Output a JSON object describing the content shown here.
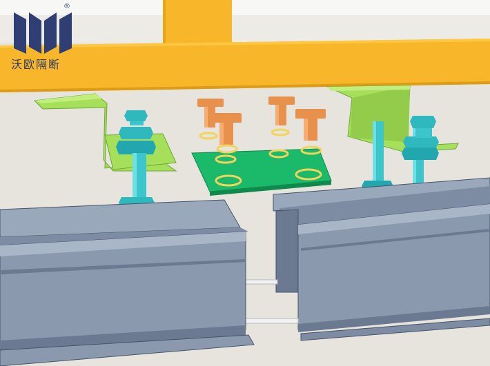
{
  "logo": {
    "brand_text": "沃欧隔断",
    "registered_mark": "®",
    "color": "#2f3f73"
  },
  "scene": {
    "ceiling_color": "#fbfbfa",
    "wall_color": "#e3e1d9",
    "beam_color": "#f8b72a",
    "bracket_color": "#a6e05a",
    "plate_color": "#1bb96a",
    "bolt_color": "#3cc6cc",
    "tbolt_color": "#e8914c",
    "washer_color": "#f2d45a",
    "rail_color": "#8a99ae"
  }
}
